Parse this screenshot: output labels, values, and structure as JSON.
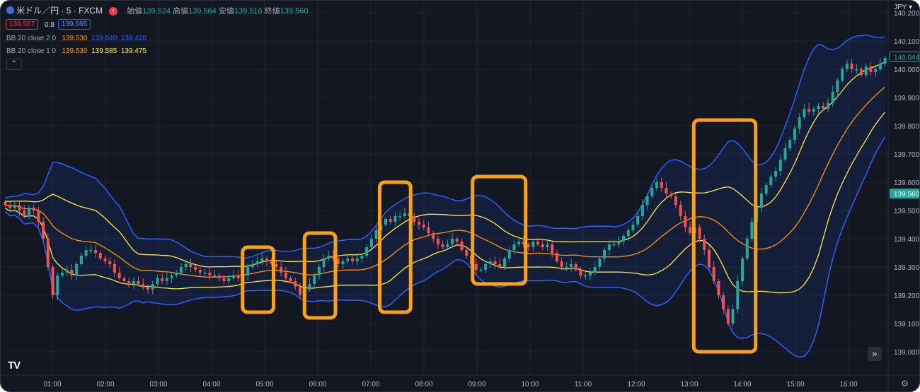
{
  "header": {
    "symbol": "米ドル／円 · 5 · FXCM",
    "open_label": "始値",
    "open_value": "139.524",
    "high_label": "高値",
    "high_value": "139.564",
    "low_label": "安値",
    "low_value": "139.516",
    "close_label": "終値",
    "close_value": "139.560",
    "bid": "139.557",
    "spread": "0.8",
    "ask": "139.565"
  },
  "indicators": [
    {
      "label": "BB 20 close 2 0",
      "basis": "139.530",
      "upper": "139.640",
      "lower": "139.420"
    },
    {
      "label": "BB 20 close 1 0",
      "basis": "139.530",
      "upper": "139.585",
      "lower": "139.475"
    }
  ],
  "currency": "JPY",
  "colors": {
    "bg": "#131722",
    "up": "#26a69a",
    "down": "#ef5350",
    "basis": "#ff9800",
    "bb2": "#2962ff",
    "bb1": "#ffeb3b",
    "highlight": "#f7a21b",
    "grid": "#1f2431",
    "text": "#b2b5be"
  },
  "icons": {
    "collapse": "chevron-up-icon",
    "scroll": "double-chevron-right-icon",
    "settings": "gear-icon",
    "logo": "tradingview-logo-icon"
  },
  "chart_data": {
    "type": "candlestick",
    "y_ticks": [
      "140.200",
      "140.100",
      "140.000",
      "139.900",
      "139.800",
      "139.700",
      "139.600",
      "139.500",
      "139.400",
      "139.300",
      "139.200",
      "139.100",
      "139.000"
    ],
    "x_ticks": [
      "01:00",
      "02:00",
      "03:00",
      "04:00",
      "05:00",
      "06:00",
      "07:00",
      "08:00",
      "09:00",
      "10:00",
      "11:00",
      "12:00",
      "13:00",
      "14:00",
      "15:00",
      "16:00"
    ],
    "ylim": [
      138.99,
      140.22
    ],
    "current_price_label": "140.044",
    "close_price_label": "139.560",
    "highlight_boxes": [
      {
        "from": "04:35",
        "to": "05:10",
        "low": 139.14,
        "high": 139.37
      },
      {
        "from": "05:45",
        "to": "06:20",
        "low": 139.12,
        "high": 139.42
      },
      {
        "from": "07:10",
        "to": "07:45",
        "low": 139.14,
        "high": 139.6
      },
      {
        "from": "08:55",
        "to": "09:55",
        "low": 139.24,
        "high": 139.62
      },
      {
        "from": "13:05",
        "to": "14:15",
        "low": 139.0,
        "high": 139.82
      }
    ],
    "closes": [
      139.52,
      139.51,
      139.52,
      139.5,
      139.48,
      139.51,
      139.5,
      139.46,
      139.4,
      139.3,
      139.2,
      139.27,
      139.28,
      139.29,
      139.27,
      139.31,
      139.34,
      139.36,
      139.36,
      139.35,
      139.33,
      139.32,
      139.31,
      139.28,
      139.26,
      139.25,
      139.24,
      139.25,
      139.24,
      139.23,
      139.22,
      139.24,
      139.26,
      139.25,
      139.26,
      139.27,
      139.28,
      139.3,
      139.31,
      139.3,
      139.29,
      139.28,
      139.28,
      139.27,
      139.27,
      139.26,
      139.25,
      139.26,
      139.27,
      139.26,
      139.27,
      139.3,
      139.31,
      139.32,
      139.33,
      139.32,
      139.31,
      139.3,
      139.28,
      139.26,
      139.25,
      139.23,
      139.2,
      139.22,
      139.24,
      139.27,
      139.3,
      139.33,
      139.34,
      139.33,
      139.31,
      139.32,
      139.33,
      139.32,
      139.33,
      139.34,
      139.37,
      139.4,
      139.43,
      139.45,
      139.47,
      139.46,
      139.48,
      139.48,
      139.49,
      139.48,
      139.46,
      139.45,
      139.44,
      139.42,
      139.4,
      139.38,
      139.37,
      139.38,
      139.4,
      139.39,
      139.36,
      139.34,
      139.31,
      139.29,
      139.29,
      139.31,
      139.32,
      139.31,
      139.3,
      139.33,
      139.36,
      139.38,
      139.39,
      139.38,
      139.37,
      139.39,
      139.38,
      139.37,
      139.38,
      139.35,
      139.32,
      139.3,
      139.3,
      139.31,
      139.29,
      139.27,
      139.27,
      139.28,
      139.3,
      139.33,
      139.36,
      139.38,
      139.38,
      139.39,
      139.41,
      139.43,
      139.45,
      139.48,
      139.52,
      139.55,
      139.58,
      139.6,
      139.58,
      139.56,
      139.55,
      139.52,
      139.48,
      139.44,
      139.42,
      139.44,
      139.4,
      139.36,
      139.3,
      139.25,
      139.2,
      139.15,
      139.1,
      139.15,
      139.25,
      139.33,
      139.4,
      139.46,
      139.51,
      139.56,
      139.59,
      139.62,
      139.64,
      139.68,
      139.72,
      139.75,
      139.79,
      139.83,
      139.86,
      139.85,
      139.86,
      139.87,
      139.86,
      139.88,
      139.92,
      139.96,
      140.0,
      140.02,
      140.0,
      140.0,
      139.98,
      140.01,
      139.99,
      140.0,
      140.02,
      140.04
    ]
  }
}
